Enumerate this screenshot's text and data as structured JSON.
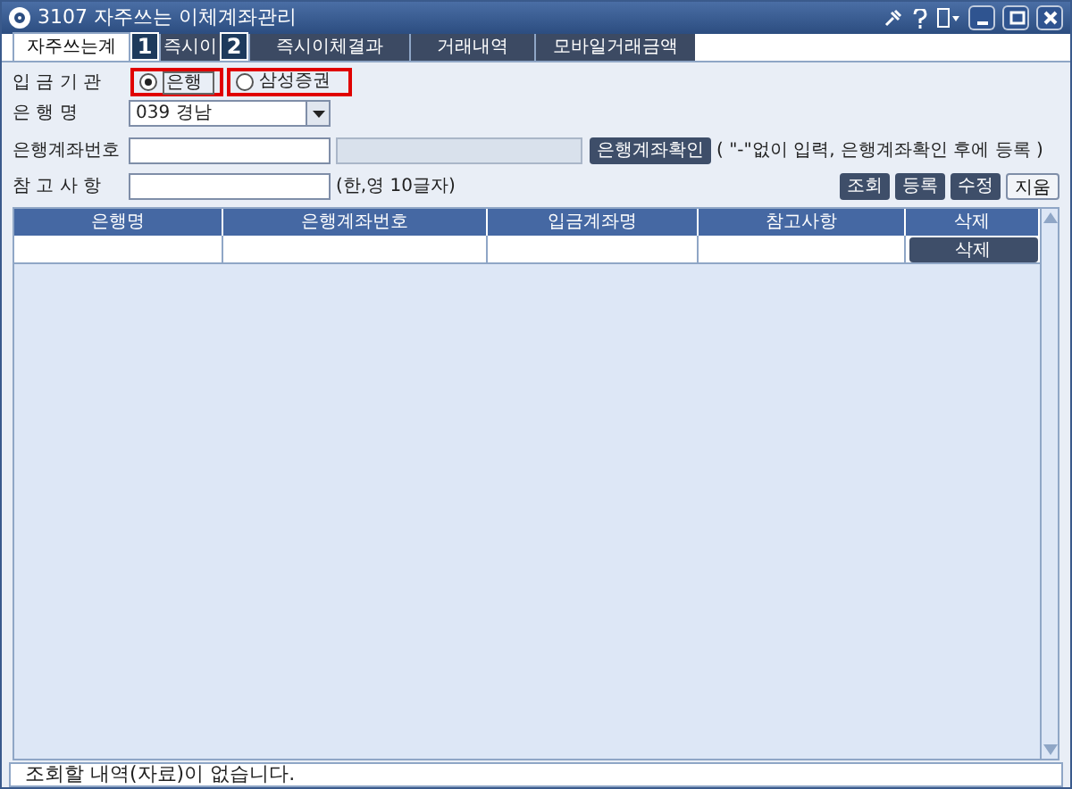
{
  "window": {
    "title": "3107 자주쓰는 이체계좌관리"
  },
  "tabs": [
    {
      "label": "자주쓰는계",
      "selected": true
    },
    {
      "label": "즉시이",
      "selected": false
    },
    {
      "label": "즉시이체결과",
      "selected": false
    },
    {
      "label": "거래내역",
      "selected": false
    },
    {
      "label": "모바일거래금액",
      "selected": false
    }
  ],
  "annotations": [
    {
      "label": "1"
    },
    {
      "label": "2"
    }
  ],
  "institution": {
    "label": "입 금 기 관",
    "options": [
      {
        "label": "은행",
        "selected": true
      },
      {
        "label": "삼성증권",
        "selected": false
      }
    ]
  },
  "bank": {
    "label": "은 행 명",
    "value": "039 경남"
  },
  "account": {
    "label": "은행계좌번호",
    "button": "은행계좌확인",
    "hint": "( \"-\"없이 입력, 은행계좌확인 후에 등록 )"
  },
  "memo": {
    "label": "참 고 사 항",
    "hint": "(한,영 10글자)"
  },
  "actions": [
    "조회",
    "등록",
    "수정",
    "지움"
  ],
  "table": {
    "columns": [
      "은행명",
      "은행계좌번호",
      "입금계좌명",
      "참고사항",
      "삭제"
    ],
    "rows": [
      {
        "delete_button": "삭제"
      }
    ]
  },
  "status_bar": "조회할 내역(자료)이 없습니다."
}
